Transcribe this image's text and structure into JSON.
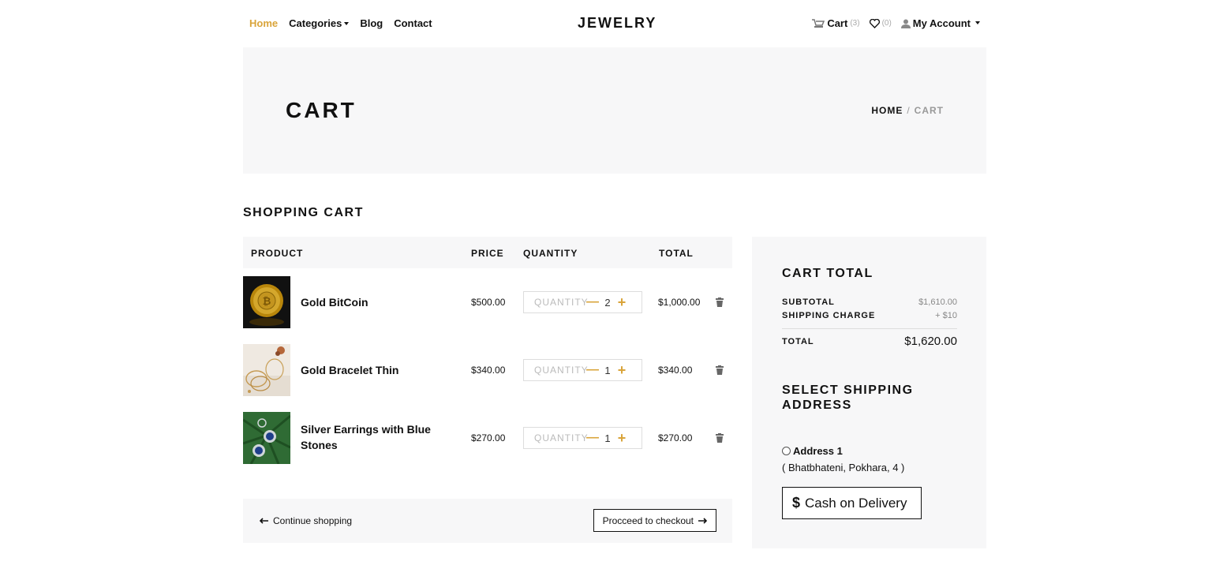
{
  "header": {
    "nav": [
      {
        "label": "Home",
        "active": true
      },
      {
        "label": "Categories",
        "dropdown": true
      },
      {
        "label": "Blog"
      },
      {
        "label": "Contact"
      }
    ],
    "logo": "JEWELRY",
    "cart_label": "Cart",
    "cart_count": "(3)",
    "wishlist_count": "(0)",
    "account_label": "My Account",
    "accent_color": "#d9a43a"
  },
  "banner": {
    "title": "CART",
    "breadcrumb_home": "HOME",
    "breadcrumb_sep": "/",
    "breadcrumb_current": "CART"
  },
  "cart": {
    "title": "SHOPPING CART",
    "columns": [
      "PRODUCT",
      "PRICE",
      "QUANTITY",
      "TOTAL"
    ],
    "quantity_placeholder": "QUANTITY",
    "items": [
      {
        "name": "Gold BitCoin",
        "price": "$500.00",
        "quantity": "2",
        "total": "$1,000.00"
      },
      {
        "name": "Gold Bracelet Thin",
        "price": "$340.00",
        "quantity": "1",
        "total": "$340.00"
      },
      {
        "name": "Silver Earrings with Blue Stones",
        "price": "$270.00",
        "quantity": "1",
        "total": "$270.00"
      }
    ],
    "continue_label": "Continue shopping",
    "checkout_label": "Procceed to checkout"
  },
  "summary": {
    "title": "CART TOTAL",
    "subtotal_label": "SUBTOTAL",
    "subtotal_value": "$1,610.00",
    "shipping_label": "SHIPPING CHARGE",
    "shipping_value": "+ $10",
    "total_label": "TOTAL",
    "total_value": "$1,620.00",
    "ship_title": "SELECT SHIPPING ADDRESS",
    "address_name": "Address 1",
    "address_detail": "( Bhatbhateni, Pokhara, 4 )",
    "cod_label": "Cash on Delivery"
  }
}
